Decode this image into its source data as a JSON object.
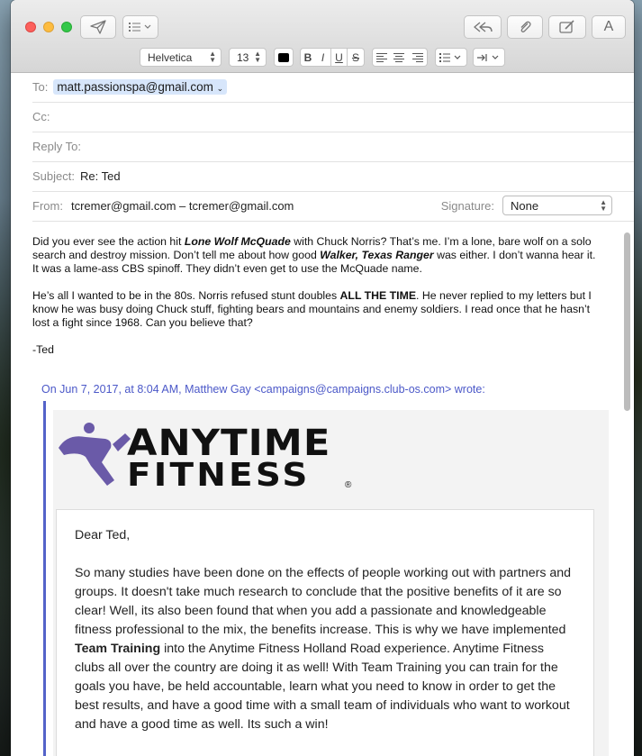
{
  "colors": {
    "accent_blue": "#4b58c8",
    "token_bg": "#d7e6fb"
  },
  "toolbar": {
    "send_icon": "paper-plane-icon",
    "header_fields_icon": "list-icon",
    "reply_icon": "reply-all-icon",
    "attach_icon": "paperclip-icon",
    "markup_icon": "markup-icon",
    "fonts_label": "A"
  },
  "format": {
    "font": "Helvetica",
    "size": "13",
    "bold": "B",
    "italic": "I",
    "underline": "U",
    "strike": "S"
  },
  "headers": {
    "to_label": "To:",
    "to_value": "matt.passionspa@gmail.com",
    "cc_label": "Cc:",
    "replyto_label": "Reply To:",
    "subject_label": "Subject:",
    "subject_value": "Re: Ted",
    "from_label": "From:",
    "from_value": "tcremer@gmail.com – tcremer@gmail.com",
    "signature_label": "Signature:",
    "signature_value": "None"
  },
  "message": {
    "p1_a": "Did you ever see the action hit ",
    "p1_b": "Lone Wolf McQuade",
    "p1_c": " with Chuck Norris? That’s me. I’m a lone, bare wolf on a solo search and destroy mission. Don’t tell me about how good ",
    "p1_d": "Walker, Texas Ranger",
    "p1_e": " was either. I don’t wanna hear it. It was a lame-ass CBS spinoff. They didn’t even get to use the McQuade name.",
    "p2_a": "He’s all I wanted to be in the 80s. Norris refused stunt doubles ",
    "p2_b": "ALL THE TIME",
    "p2_c": ". He never replied to my letters but I know he was busy doing Chuck stuff, fighting bears and mountains and enemy soldiers. I read once that he hasn’t lost a fight since 1968. Can you believe that?",
    "signoff": "-Ted"
  },
  "quote": {
    "header": "On Jun 7, 2017, at 8:04 AM, Matthew Gay <campaigns@campaigns.club-os.com> wrote:",
    "logo_line1": "ANYTIME",
    "logo_line2": "FITNESS",
    "logo_mark": "®",
    "greeting": "Dear Ted,",
    "para_a": "So many studies have been done on the effects of people working out with partners and groups. It doesn't take much research to conclude that the positive benefits of it are so clear! Well, its also been found that when you add a passionate and knowledgeable fitness professional to the mix, the benefits increase. This is why we have implemented ",
    "para_b": "Team Training",
    "para_c": " into the Anytime Fitness Holland Road experience. Anytime Fitness clubs all over the country are doing it as well! With Team Training you can train for the goals you have, be held accountable, learn what you need to know in order to get the best results, and have a good time with a small team of individuals who want to workout and have a good time as well. Its such a win!"
  }
}
